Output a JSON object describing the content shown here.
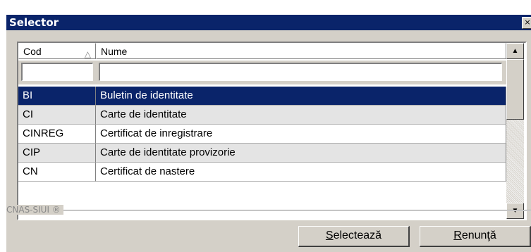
{
  "window": {
    "title": "Selector",
    "close_label": "×"
  },
  "grid": {
    "columns": [
      {
        "label": "Cod",
        "sort_icon": "sort-ascending-icon"
      },
      {
        "label": "Nume"
      }
    ],
    "filters": {
      "cod": "",
      "nume": ""
    },
    "rows": [
      {
        "cod": "BI",
        "nume": "Buletin de identitate",
        "selected": true
      },
      {
        "cod": "CI",
        "nume": "Carte de identitate",
        "selected": false
      },
      {
        "cod": "CINREG",
        "nume": "Certificat de inregistrare",
        "selected": false
      },
      {
        "cod": "CIP",
        "nume": "Carte de identitate provizorie",
        "selected": false
      },
      {
        "cod": "CN",
        "nume": "Certificat de nastere",
        "selected": false
      }
    ]
  },
  "group_label": "CNAS-SIUI ®",
  "buttons": {
    "select_mnemonic": "S",
    "select_rest": "electează",
    "cancel_mnemonic": "R",
    "cancel_rest": "enunţă"
  },
  "colors": {
    "selection": "#0a246a",
    "face": "#d4d0c8"
  }
}
